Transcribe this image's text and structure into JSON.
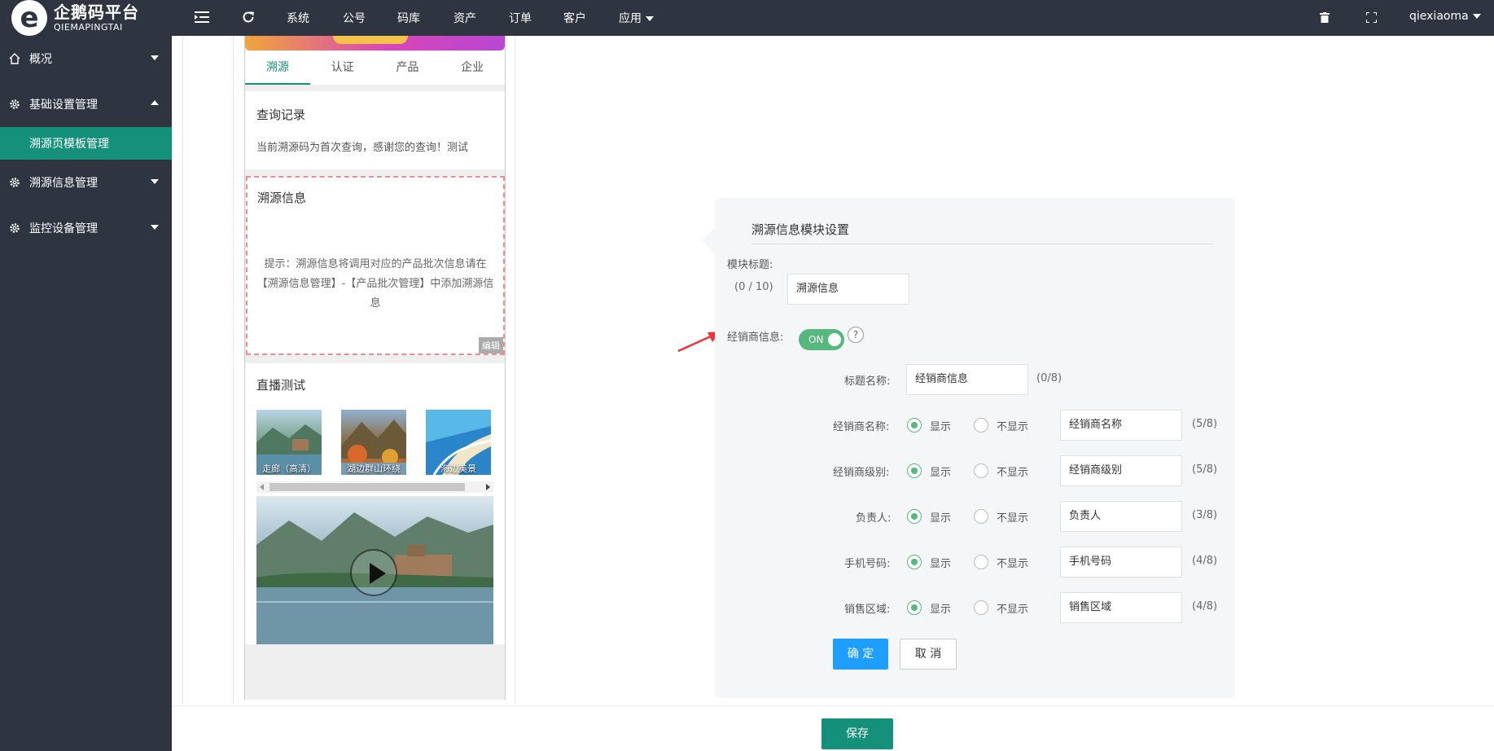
{
  "app": {
    "logo_mark": "e",
    "logo_cn": "企鹅码平台",
    "logo_en": "QIEMAPINGTAI"
  },
  "topnav": {
    "items": [
      "系统",
      "公号",
      "码库",
      "资产",
      "订单",
      "客户",
      "应用"
    ],
    "user": "qiexiaoma"
  },
  "sidebar": {
    "items": [
      {
        "label": "概况"
      },
      {
        "label": "基础设置管理"
      },
      {
        "label": "溯源页模板管理"
      },
      {
        "label": "溯源信息管理"
      },
      {
        "label": "监控设备管理"
      }
    ]
  },
  "preview": {
    "tabs": [
      "溯源",
      "认证",
      "产品",
      "企业"
    ],
    "query": {
      "title": "查询记录",
      "text": "当前溯源码为首次查询，感谢您的查询！测试"
    },
    "trace": {
      "title": "溯源信息",
      "tip": "提示：溯源信息将调用对应的产品批次信息请在【溯源信息管理】-【产品批次管理】中添加溯源信息",
      "edit": "编辑"
    },
    "live": {
      "title": "直播测试",
      "thumbs": [
        "走廊（高清）",
        "湖边群山环绕",
        "海边美景"
      ]
    }
  },
  "panel": {
    "title": "溯源信息模块设置",
    "module_title_label": "模块标题:",
    "module_title_count": "(0 / 10)",
    "module_title_value": "溯源信息",
    "dealer_label": "经销商信息:",
    "switch_text": "ON",
    "help": "?",
    "heading_label": "标题名称:",
    "heading_value": "经销商信息",
    "heading_count": "(0/8)",
    "show": "显示",
    "hide": "不显示",
    "fields": [
      {
        "label": "经销商名称:",
        "value": "经销商名称",
        "count": "(5/8)"
      },
      {
        "label": "经销商级别:",
        "value": "经销商级别",
        "count": "(5/8)"
      },
      {
        "label": "负责人:",
        "value": "负责人",
        "count": "(3/8)"
      },
      {
        "label": "手机号码:",
        "value": "手机号码",
        "count": "(4/8)"
      },
      {
        "label": "销售区域:",
        "value": "销售区域",
        "count": "(4/8)"
      }
    ],
    "ok": "确 定",
    "cancel": "取 消"
  },
  "footer": {
    "save": "保存"
  },
  "colors": {
    "primary": "#15907a",
    "dark": "#2e3440",
    "blue": "#1e9fff",
    "green": "#56b87e"
  }
}
